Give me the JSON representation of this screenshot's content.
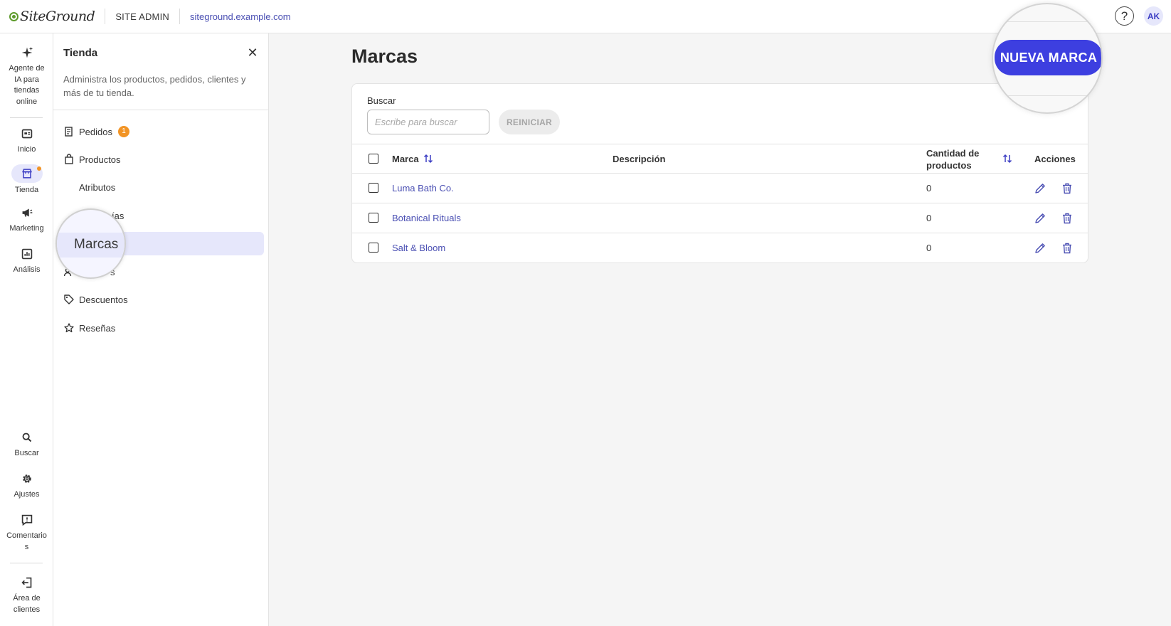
{
  "header": {
    "logo_text": "SiteGround",
    "section": "SITE ADMIN",
    "site_url": "siteground.example.com",
    "help_symbol": "?",
    "avatar_initials": "AK"
  },
  "rail": {
    "items": [
      {
        "label": "Agente de IA para tiendas online",
        "icon": "sparkle-icon"
      },
      {
        "label": "Inicio",
        "icon": "dashboard-icon"
      },
      {
        "label": "Tienda",
        "icon": "store-icon",
        "active": true
      },
      {
        "label": "Marketing",
        "icon": "megaphone-icon"
      },
      {
        "label": "Análisis",
        "icon": "chart-icon"
      },
      {
        "label": "Buscar",
        "icon": "search-icon"
      },
      {
        "label": "Ajustes",
        "icon": "gear-icon"
      },
      {
        "label": "Comentarios",
        "icon": "comment-icon"
      },
      {
        "label": "Área de clientes",
        "icon": "logout-icon"
      }
    ]
  },
  "panel": {
    "title": "Tienda",
    "close_symbol": "✕",
    "description": "Administra los productos, pedidos, clientes y más de tu tienda.",
    "menu": [
      {
        "label": "Pedidos",
        "badge": "1",
        "icon": "receipt-icon"
      },
      {
        "label": "Productos",
        "icon": "bag-icon"
      },
      {
        "label": "Atributos"
      },
      {
        "label": "ías"
      },
      {
        "label": "Marcas",
        "active": true
      },
      {
        "label": "s",
        "icon": "users-icon"
      },
      {
        "label": "Descuentos",
        "icon": "tag-icon"
      },
      {
        "label": "Reseñas",
        "icon": "star-icon"
      }
    ]
  },
  "main": {
    "title": "Marcas",
    "new_button": "NUEVA MARCA",
    "search": {
      "label": "Buscar",
      "placeholder": "Escribe para buscar",
      "value": "",
      "reset_label": "REINICIAR"
    },
    "table": {
      "columns": {
        "brand": "Marca",
        "description": "Descripción",
        "quantity_line1": "Cantidad de",
        "quantity_line2": "productos",
        "actions": "Acciones"
      },
      "rows": [
        {
          "brand": "Luma Bath Co.",
          "description": "",
          "quantity": "0"
        },
        {
          "brand": "Botanical Rituals",
          "description": "",
          "quantity": "0"
        },
        {
          "brand": "Salt & Bloom",
          "description": "",
          "quantity": "0"
        }
      ]
    }
  },
  "colors": {
    "accent": "#3d3fe0",
    "link": "#4a4fb3",
    "badge": "#f29425",
    "active_bg": "#e6e7fb"
  }
}
